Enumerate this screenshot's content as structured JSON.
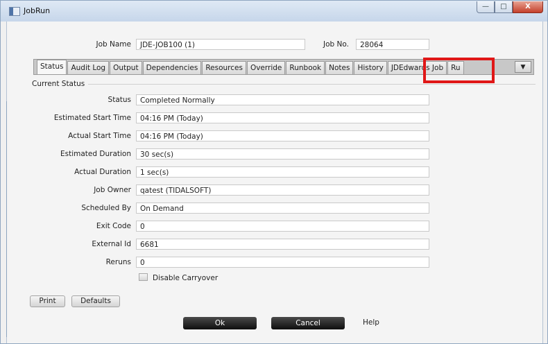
{
  "window": {
    "title": "JobRun",
    "controls": {
      "minimize": "—",
      "maximize": "□",
      "close": "X"
    }
  },
  "header": {
    "job_name_label": "Job Name",
    "job_name_value": "JDE-JOB100 (1)",
    "job_no_label": "Job No.",
    "job_no_value": "28064"
  },
  "tabs": [
    {
      "label": "Status"
    },
    {
      "label": "Audit Log"
    },
    {
      "label": "Output"
    },
    {
      "label": "Dependencies"
    },
    {
      "label": "Resources"
    },
    {
      "label": "Override"
    },
    {
      "label": "Runbook"
    },
    {
      "label": "Notes"
    },
    {
      "label": "History"
    },
    {
      "label": "JDEdwards Job"
    },
    {
      "label": "Ru"
    }
  ],
  "tab_overflow_icon": "chevron-down-icon",
  "highlight_color": "#e01717",
  "section": {
    "title": "Current Status"
  },
  "fields": {
    "status": {
      "label": "Status",
      "value": "Completed Normally"
    },
    "est_start": {
      "label": "Estimated Start Time",
      "value": "04:16 PM (Today)"
    },
    "act_start": {
      "label": "Actual Start Time",
      "value": "04:16 PM (Today)"
    },
    "est_duration": {
      "label": "Estimated Duration",
      "value": "30 sec(s)"
    },
    "act_duration": {
      "label": "Actual Duration",
      "value": "1 sec(s)"
    },
    "owner": {
      "label": "Job Owner",
      "value": "qatest (TIDALSOFT)"
    },
    "scheduled_by": {
      "label": "Scheduled By",
      "value": "On Demand"
    },
    "exit_code": {
      "label": "Exit Code",
      "value": "0"
    },
    "external_id": {
      "label": "External Id",
      "value": "6681"
    },
    "reruns": {
      "label": "Reruns",
      "value": "0"
    }
  },
  "disable_carryover": {
    "label": "Disable Carryover",
    "checked": false
  },
  "buttons": {
    "print": "Print",
    "defaults": "Defaults",
    "ok": "Ok",
    "cancel": "Cancel",
    "help": "Help"
  }
}
